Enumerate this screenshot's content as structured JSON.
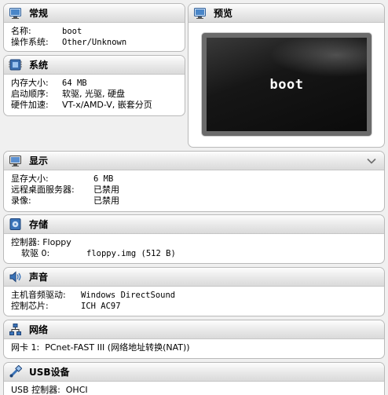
{
  "general": {
    "title": "常规",
    "name_label": "名称:",
    "name_value": "boot",
    "os_label": "操作系统:",
    "os_value": "Other/Unknown"
  },
  "system": {
    "title": "系统",
    "memory_label": "内存大小:",
    "memory_value": "64 MB",
    "boot_label": "启动顺序:",
    "boot_value": "软驱, 光驱, 硬盘",
    "accel_label": "硬件加速:",
    "accel_value": "VT-x/AMD-V, 嵌套分页"
  },
  "preview": {
    "title": "预览",
    "screen_text": "boot"
  },
  "display": {
    "title": "显示",
    "vram_label": "显存大小:",
    "vram_value": "6 MB",
    "rdp_label": "远程桌面服务器:",
    "rdp_value": "已禁用",
    "record_label": "录像:",
    "record_value": "已禁用"
  },
  "storage": {
    "title": "存储",
    "controller_text": "控制器: Floppy",
    "floppy_label": "软驱 0:",
    "floppy_value": "floppy.img (512 B)"
  },
  "audio": {
    "title": "声音",
    "driver_label": "主机音频驱动:",
    "driver_value": "Windows DirectSound",
    "chip_label": "控制芯片:",
    "chip_value": "ICH AC97"
  },
  "network": {
    "title": "网络",
    "adapter_text": "网卡 1:  PCnet-FAST III (网络地址转换(NAT))"
  },
  "usb": {
    "title": "USB设备",
    "controller_text": "USB 控制器:  OHCI"
  },
  "icons": [
    "general-icon",
    "system-icon",
    "preview-icon",
    "display-icon",
    "storage-icon",
    "audio-icon",
    "network-icon",
    "usb-icon",
    "chevron-down-icon"
  ]
}
